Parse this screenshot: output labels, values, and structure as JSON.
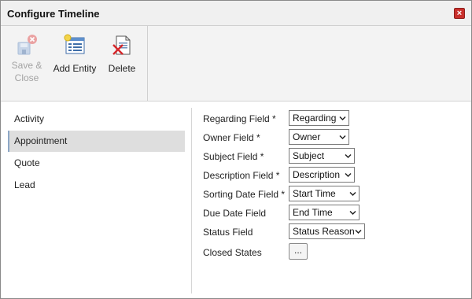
{
  "window": {
    "title": "Configure Timeline",
    "close_glyph": "×"
  },
  "ribbon": {
    "save_label_1": "Save &",
    "save_label_2": "Close",
    "add_label": "Add Entity",
    "delete_label": "Delete"
  },
  "entities": {
    "items": [
      {
        "label": "Activity"
      },
      {
        "label": "Appointment"
      },
      {
        "label": "Quote"
      },
      {
        "label": "Lead"
      }
    ],
    "selected": "Appointment"
  },
  "fields": {
    "regarding": {
      "label": "Regarding Field *",
      "value": "Regarding"
    },
    "owner": {
      "label": "Owner Field *",
      "value": "Owner"
    },
    "subject": {
      "label": "Subject Field *",
      "value": "Subject"
    },
    "description": {
      "label": "Description Field *",
      "value": "Description"
    },
    "sorting_date": {
      "label": "Sorting Date Field *",
      "value": "Start Time"
    },
    "due_date": {
      "label": "Due Date Field",
      "value": "End Time"
    },
    "status": {
      "label": "Status Field",
      "value": "Status Reason"
    },
    "closed_states": {
      "label": "Closed States",
      "button": "..."
    }
  },
  "colors": {
    "close_button": "#c9302c",
    "selected_item": "#dedede",
    "disabled_text": "#a3a3a3"
  }
}
